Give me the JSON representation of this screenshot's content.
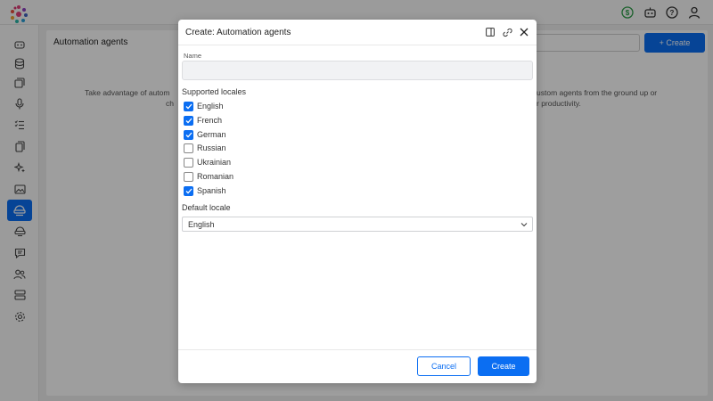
{
  "header": {
    "icons": [
      "logo-icon",
      "billing-dollar-icon",
      "bot-icon",
      "help-icon",
      "user-icon"
    ],
    "accent": "#0b6ef2",
    "billing_color": "#2e9e4a"
  },
  "sidebar": {
    "items": [
      {
        "icon": "bot-icon"
      },
      {
        "icon": "database-icon"
      },
      {
        "icon": "copy-icon"
      },
      {
        "icon": "microphone-icon"
      },
      {
        "icon": "checklist-icon"
      },
      {
        "icon": "documents-icon"
      },
      {
        "icon": "sparkles-icon"
      },
      {
        "icon": "image-icon"
      },
      {
        "icon": "automation-agent-icon",
        "active": true
      },
      {
        "icon": "support-agent-icon"
      },
      {
        "icon": "chat-icon"
      },
      {
        "icon": "users-icon"
      },
      {
        "icon": "server-icon"
      },
      {
        "icon": "settings-icon"
      }
    ]
  },
  "main": {
    "title": "Automation agents",
    "create_label": "+ Create",
    "desc_left_1": "Take advantage of autom",
    "desc_left_2": "ch",
    "desc_right_1": "ustom agents from the ground up or",
    "desc_right_2": "r productivity."
  },
  "modal": {
    "title": "Create: Automation agents",
    "name_label": "Name",
    "name_value": "",
    "locales_label": "Supported locales",
    "locales": [
      {
        "label": "English",
        "checked": true
      },
      {
        "label": "French",
        "checked": true
      },
      {
        "label": "German",
        "checked": true
      },
      {
        "label": "Russian",
        "checked": false
      },
      {
        "label": "Ukrainian",
        "checked": false
      },
      {
        "label": "Romanian",
        "checked": false
      },
      {
        "label": "Spanish",
        "checked": true
      }
    ],
    "default_locale_label": "Default locale",
    "default_locale_value": "English",
    "cancel_label": "Cancel",
    "create_label": "Create"
  }
}
